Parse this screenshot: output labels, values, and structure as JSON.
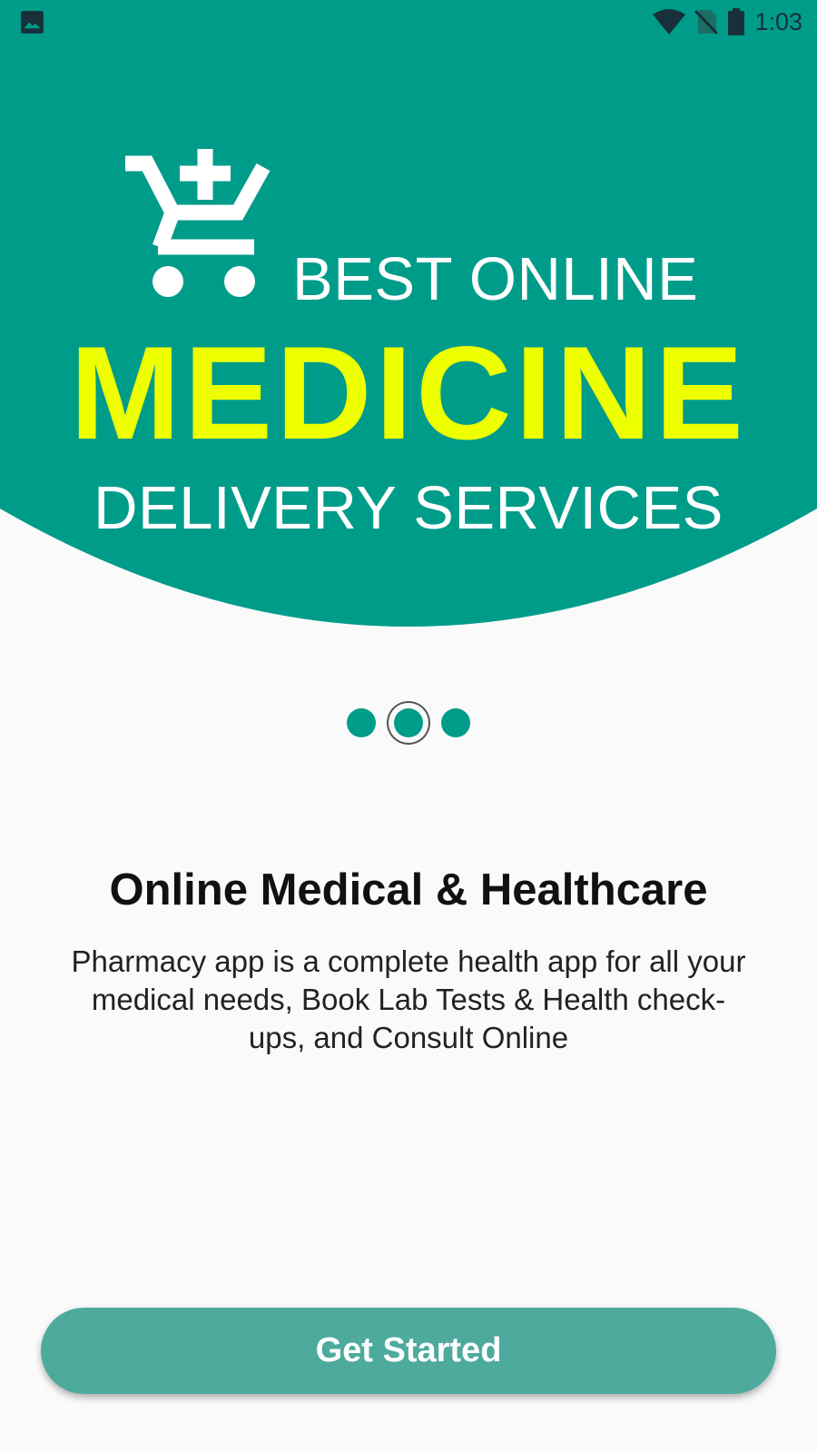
{
  "status_bar": {
    "time": "1:03",
    "icons": [
      "image-icon",
      "wifi-icon",
      "no-sim-icon",
      "battery-icon"
    ]
  },
  "hero": {
    "line1": "BEST ONLINE",
    "line2": "MEDICINE",
    "line3": "DELIVERY SERVICES",
    "icon": "cart-plus-icon",
    "background_color": "#009C8A",
    "highlight_color": "#EEFF00"
  },
  "page_indicator": {
    "count": 3,
    "active_index": 1
  },
  "content": {
    "headline": "Online Medical & Healthcare",
    "description": "Pharmacy app is a complete health app for all your medical needs, Book Lab Tests & Health check-ups, and Consult Online"
  },
  "button": {
    "label": "Get Started",
    "color": "#4DAA9D"
  }
}
